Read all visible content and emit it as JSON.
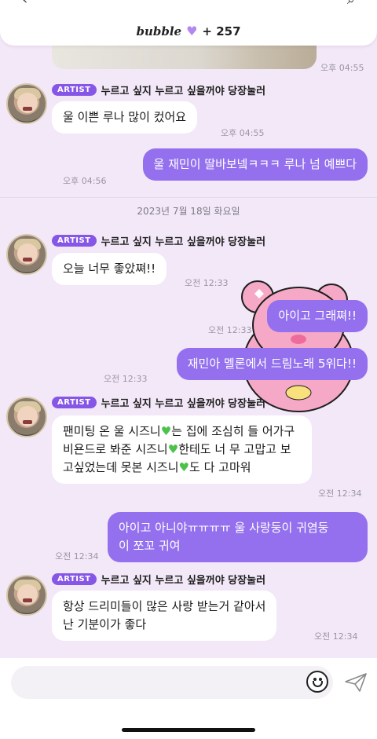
{
  "header": {
    "app_logo": "bubble",
    "heart_icon": "purple-heart",
    "count": "+ 257"
  },
  "messages": [
    {
      "type": "time",
      "time": "오후 04:55"
    },
    {
      "type": "artist",
      "badge": "ARTIST",
      "name": "누르고 싶지 누르고 싶을꺼야 당장눌러",
      "text": "울 이쁜 루나 많이 컸어요",
      "time": "오후 04:55"
    },
    {
      "type": "me",
      "text": "울 재민이 딸바보넼ㅋㅋㅋ 루나 넘 예쁘다",
      "time": "오후 04:56"
    },
    {
      "type": "date",
      "text": "2023년 7월 18일 화요일"
    },
    {
      "type": "artist",
      "badge": "ARTIST",
      "name": "누르고 싶지 누르고 싶을꺼야 당장눌러",
      "text": "오늘 너무 좋았쪄!!",
      "time": "오전 12:33"
    },
    {
      "type": "me",
      "text": "아이고 그래쪄!!",
      "time": "오전 12:33"
    },
    {
      "type": "me",
      "text": "재민아 멜론에서 드림노래 5위다!!",
      "time": "오전 12:33"
    },
    {
      "type": "artist",
      "badge": "ARTIST",
      "name": "누르고 싶지 누르고 싶을꺼야 당장눌러",
      "text_parts": [
        "팬미팅 온 울 시즈니",
        "는 집에 조심히 들",
        "어가구 비욘드로 봐준 시즈니",
        "한테도 너",
        "무 고맙고 보고싶었는데 못본 시즈니",
        "도",
        "다 고마워"
      ],
      "time": "오전 12:34"
    },
    {
      "type": "me",
      "text_lines": [
        "아이고 아니야ㅠㅠㅠㅠ 울 사랑둥이 귀염둥",
        "이 쪼꼬 귀여"
      ],
      "time": "오전 12:34"
    },
    {
      "type": "artist",
      "badge": "ARTIST",
      "name": "누르고 싶지 누르고 싶을꺼야 당장눌러",
      "text_lines": [
        "항상 드리미들이 많은 사랑 받는거 같아서",
        "난 기분이가 좋다"
      ],
      "time": "오전 12:34"
    }
  ],
  "input": {
    "placeholder": ""
  },
  "icons": {
    "emoji": "smile-icon",
    "send": "paper-plane-icon",
    "green_heart": "green-heart-emoji"
  },
  "colors": {
    "accent": "#9470ee",
    "badge": "#8656e6",
    "background": "#f3e8f8"
  }
}
